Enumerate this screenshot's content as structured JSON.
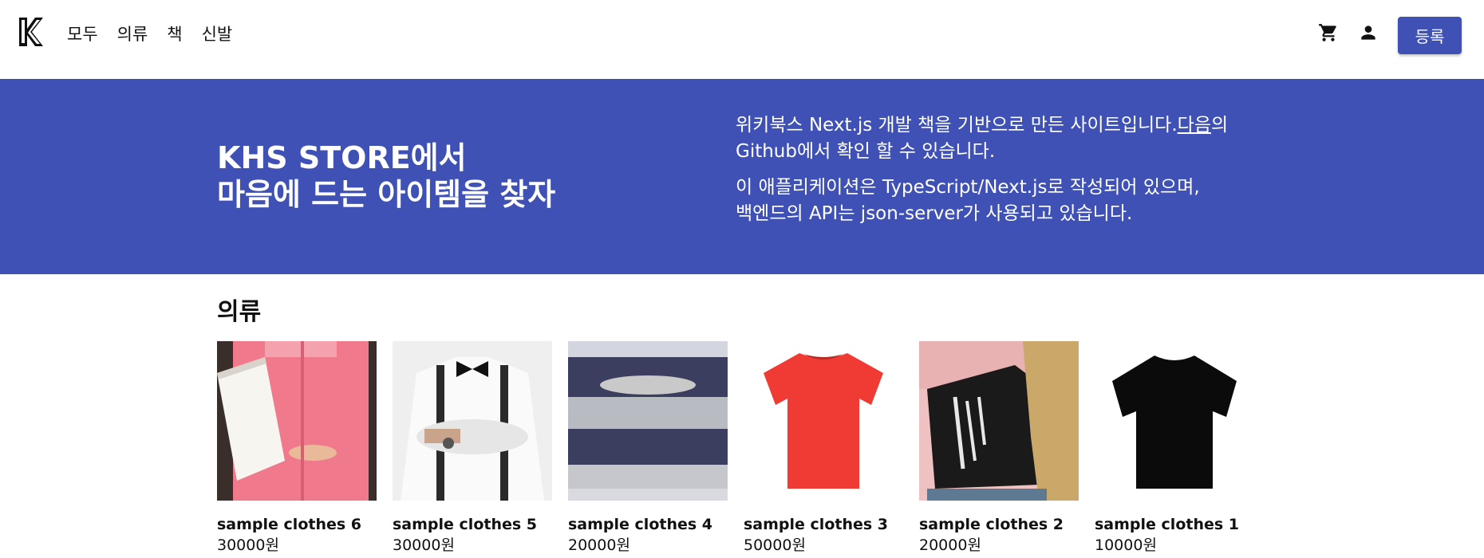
{
  "nav": {
    "logo_letter": "K",
    "items": [
      "모두",
      "의류",
      "책",
      "신발"
    ]
  },
  "header": {
    "cart_icon": "shopping-cart-icon",
    "user_icon": "person-icon",
    "register_label": "등록"
  },
  "hero": {
    "title_line1": "KHS STORE에서",
    "title_line2": "마음에 드는 아이템을 찾자",
    "desc1_before": "위키북스 Next.js 개발 책을 기반으로 만든 사이트입니다.",
    "desc1_link": "다음",
    "desc1_after": "의 Github에서 확인 할 수 있습니다.",
    "desc2_line1": "이 애플리케이션은 TypeScript/Next.js로 작성되어 있으며,",
    "desc2_line2": "백엔드의 API는 json-server가 사용되고 있습니다."
  },
  "section": {
    "title": "의류"
  },
  "products": [
    {
      "name": "sample clothes 6",
      "price": "30000원"
    },
    {
      "name": "sample clothes 5",
      "price": "30000원"
    },
    {
      "name": "sample clothes 4",
      "price": "20000원"
    },
    {
      "name": "sample clothes 3",
      "price": "50000원"
    },
    {
      "name": "sample clothes 2",
      "price": "20000원"
    },
    {
      "name": "sample clothes 1",
      "price": "10000원"
    }
  ],
  "colors": {
    "primary": "#3f51b5",
    "text": "#111111",
    "white": "#ffffff"
  }
}
